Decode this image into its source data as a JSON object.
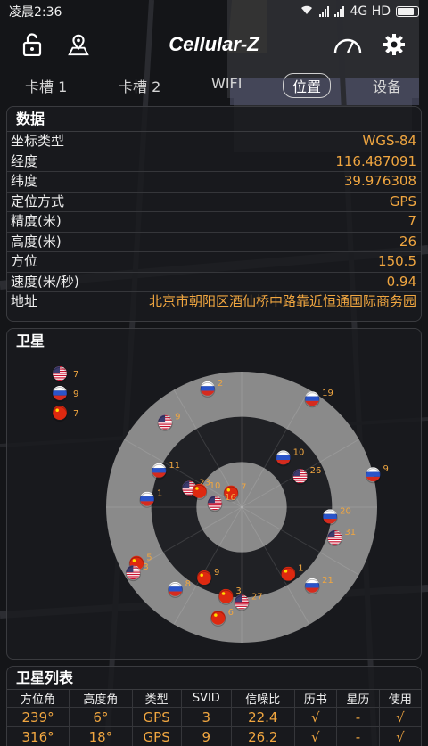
{
  "statusbar": {
    "time": "凌晨2:36",
    "network": "4G HD"
  },
  "toolbar": {
    "title": "Cellular-Z",
    "icons": [
      "unlock-icon",
      "location-icon",
      "speedometer-icon",
      "gear-icon"
    ]
  },
  "tabs": [
    {
      "label": "卡槽 1"
    },
    {
      "label": "卡槽 2"
    },
    {
      "label": "WIFI"
    },
    {
      "label": "位置",
      "active": true
    },
    {
      "label": "设备"
    }
  ],
  "data_card": {
    "title": "数据",
    "rows": [
      {
        "key": "坐标类型",
        "value": "WGS-84"
      },
      {
        "key": "经度",
        "value": "116.487091"
      },
      {
        "key": "纬度",
        "value": "39.976308"
      },
      {
        "key": "定位方式",
        "value": "GPS"
      },
      {
        "key": "精度(米)",
        "value": "7"
      },
      {
        "key": "高度(米)",
        "value": "26"
      },
      {
        "key": "方位",
        "value": "150.5"
      },
      {
        "key": "速度(米/秒)",
        "value": "0.94"
      },
      {
        "key": "地址",
        "value": "北京市朝阳区酒仙桥中路靠近恒通国际商务园"
      }
    ]
  },
  "satellite_card": {
    "title": "卫星",
    "legend": [
      {
        "flag": "us-flag-icon",
        "count": "7"
      },
      {
        "flag": "ru-flag-icon",
        "count": "9"
      },
      {
        "flag": "cn-flag-icon",
        "count": "7"
      }
    ],
    "satellites": [
      {
        "flag": "ru",
        "id": "2",
        "az": 344,
        "el": 8
      },
      {
        "flag": "ru",
        "id": "19",
        "az": 33,
        "el": 4
      },
      {
        "flag": "us",
        "id": "9",
        "az": 318,
        "el": 14
      },
      {
        "flag": "ru",
        "id": "11",
        "az": 294,
        "el": 30
      },
      {
        "flag": "ru",
        "id": "10",
        "az": 40,
        "el": 47
      },
      {
        "flag": "us",
        "id": "26",
        "az": 62,
        "el": 46
      },
      {
        "flag": "us",
        "id": "23",
        "az": 290,
        "el": 53
      },
      {
        "flag": "cn",
        "id": "10",
        "az": 291,
        "el": 60
      },
      {
        "flag": "ru",
        "id": "1",
        "az": 275,
        "el": 27
      },
      {
        "flag": "cn",
        "id": "7",
        "az": 324,
        "el": 78
      },
      {
        "flag": "us",
        "id": "16",
        "az": 279,
        "el": 72
      },
      {
        "flag": "ru",
        "id": "9",
        "az": 76,
        "el": 0
      },
      {
        "flag": "ru",
        "id": "20",
        "az": 96,
        "el": 31
      },
      {
        "flag": "us",
        "id": "31",
        "az": 108,
        "el": 25
      },
      {
        "flag": "cn",
        "id": "5",
        "az": 242,
        "el": 11
      },
      {
        "flag": "us",
        "id": "3",
        "az": 239,
        "el": 6
      },
      {
        "flag": "ru",
        "id": "8",
        "az": 219,
        "el": 20
      },
      {
        "flag": "cn",
        "id": "9",
        "az": 208,
        "el": 37
      },
      {
        "flag": "cn",
        "id": "3",
        "az": 190,
        "el": 30
      },
      {
        "flag": "us",
        "id": "27",
        "az": 180,
        "el": 27
      },
      {
        "flag": "cn",
        "id": "6",
        "az": 192,
        "el": 15
      },
      {
        "flag": "cn",
        "id": "1",
        "az": 145,
        "el": 36
      },
      {
        "flag": "ru",
        "id": "21",
        "az": 138,
        "el": 20
      }
    ]
  },
  "satlist_card": {
    "title": "卫星列表",
    "headers": [
      "方位角",
      "高度角",
      "类型",
      "SVID",
      "信噪比",
      "历书",
      "星历",
      "使用"
    ],
    "rows": [
      [
        "239°",
        "6°",
        "GPS",
        "3",
        "22.4",
        "√",
        "-",
        "√"
      ],
      [
        "316°",
        "18°",
        "GPS",
        "9",
        "26.2",
        "√",
        "-",
        "√"
      ]
    ]
  },
  "colors": {
    "accent": "#f0a640",
    "card_bg": "#1a1b1f",
    "ring": "#8f8f8f"
  }
}
